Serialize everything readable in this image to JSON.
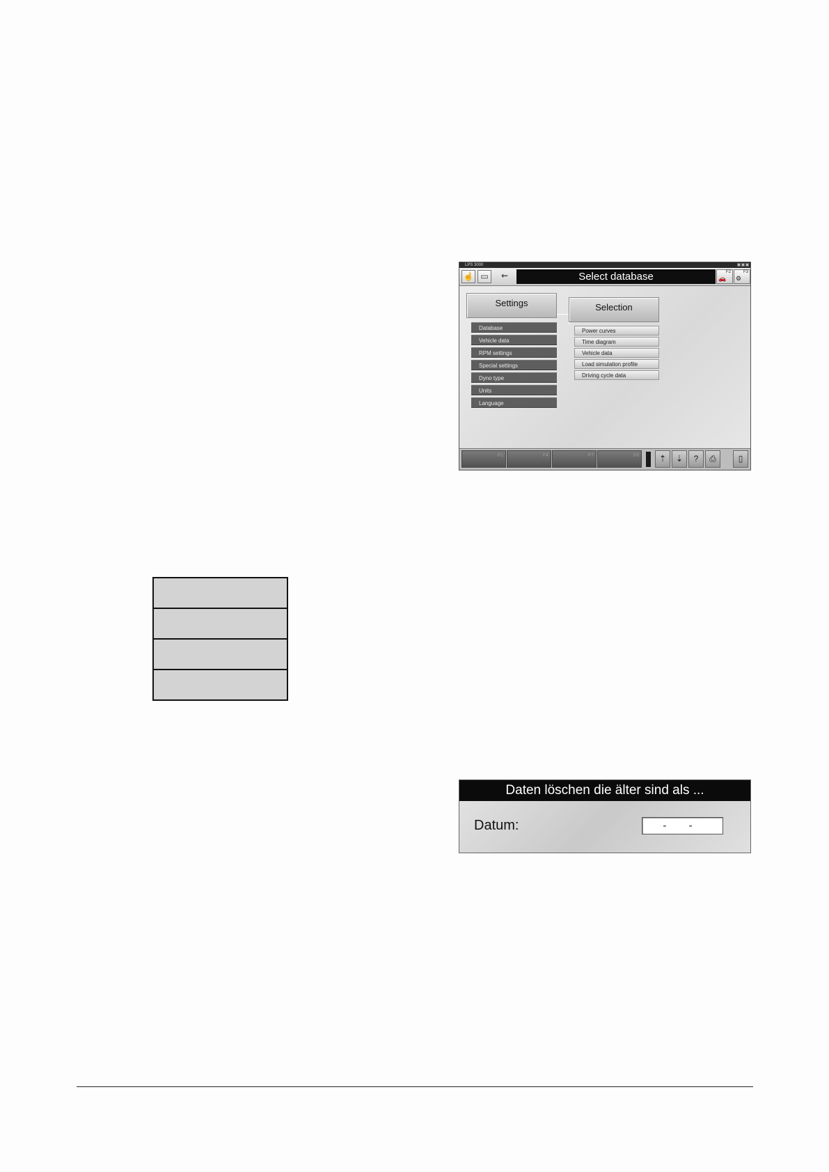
{
  "screenshot1": {
    "window_title": "LPS 3000",
    "title": "Select database",
    "toolbar_icons": [
      "hand-pointer-icon",
      "engine-icon",
      "connector-icon"
    ],
    "f2": {
      "key": "F2",
      "icon": "car-icon"
    },
    "f3": {
      "key": "F3",
      "icon": "tractor-icon"
    },
    "settings": {
      "header": "Settings",
      "items": [
        "Database",
        "Vehicle data",
        "RPM settings",
        "Special settings",
        "Dyno type",
        "Units",
        "Language"
      ]
    },
    "selection": {
      "header": "Selection",
      "items": [
        "Power curves",
        "Time diagram",
        "Vehicle data",
        "Load simulation profile",
        "Driving cycle data"
      ]
    },
    "function_keys": [
      "F1",
      "F4",
      "F7",
      "F8"
    ],
    "bottom_icons": [
      "arrow-up-icon",
      "arrow-down-icon",
      "help-icon",
      "printer-icon",
      "door-exit-icon"
    ]
  },
  "boxed_list": {
    "rows": 4
  },
  "screenshot2": {
    "title": "Daten löschen die älter sind als ...",
    "label": "Datum:",
    "date_value": "- -"
  },
  "colors": {
    "title_bar": "#0e0e0e",
    "dark_item": "#5e5e5e",
    "panel": "#e2e2e2"
  }
}
